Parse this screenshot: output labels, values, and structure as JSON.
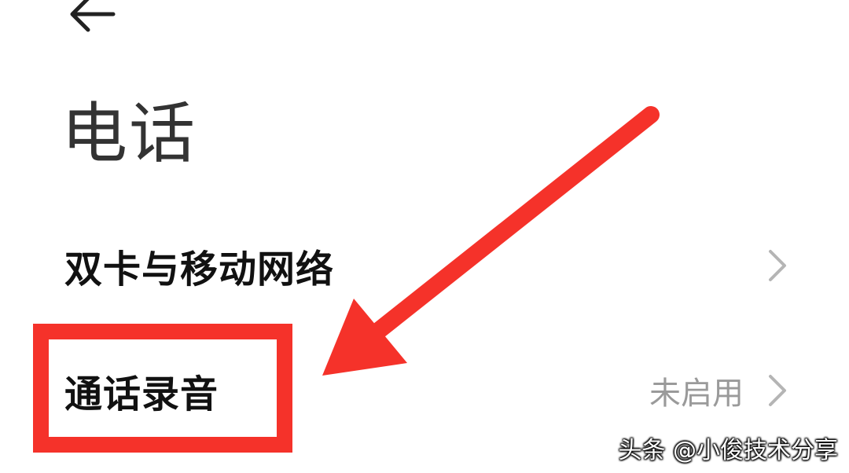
{
  "header": {
    "back_icon": "arrow-left-icon",
    "title": "电话"
  },
  "settings": {
    "items": [
      {
        "label": "双卡与移动网络",
        "value": "",
        "icon": "chevron-right-icon"
      },
      {
        "label": "通话录音",
        "value": "未启用",
        "icon": "chevron-right-icon"
      }
    ]
  },
  "annotation": {
    "highlight_color": "#f5322a",
    "arrow_color": "#f5322a",
    "highlight_target": "通话录音"
  },
  "watermark": {
    "text": "头条 @小俊技术分享"
  },
  "colors": {
    "background": "#ffffff",
    "title": "#333333",
    "label": "#111111",
    "secondary": "#9a9a9a",
    "chevron": "#b5b5b5"
  }
}
